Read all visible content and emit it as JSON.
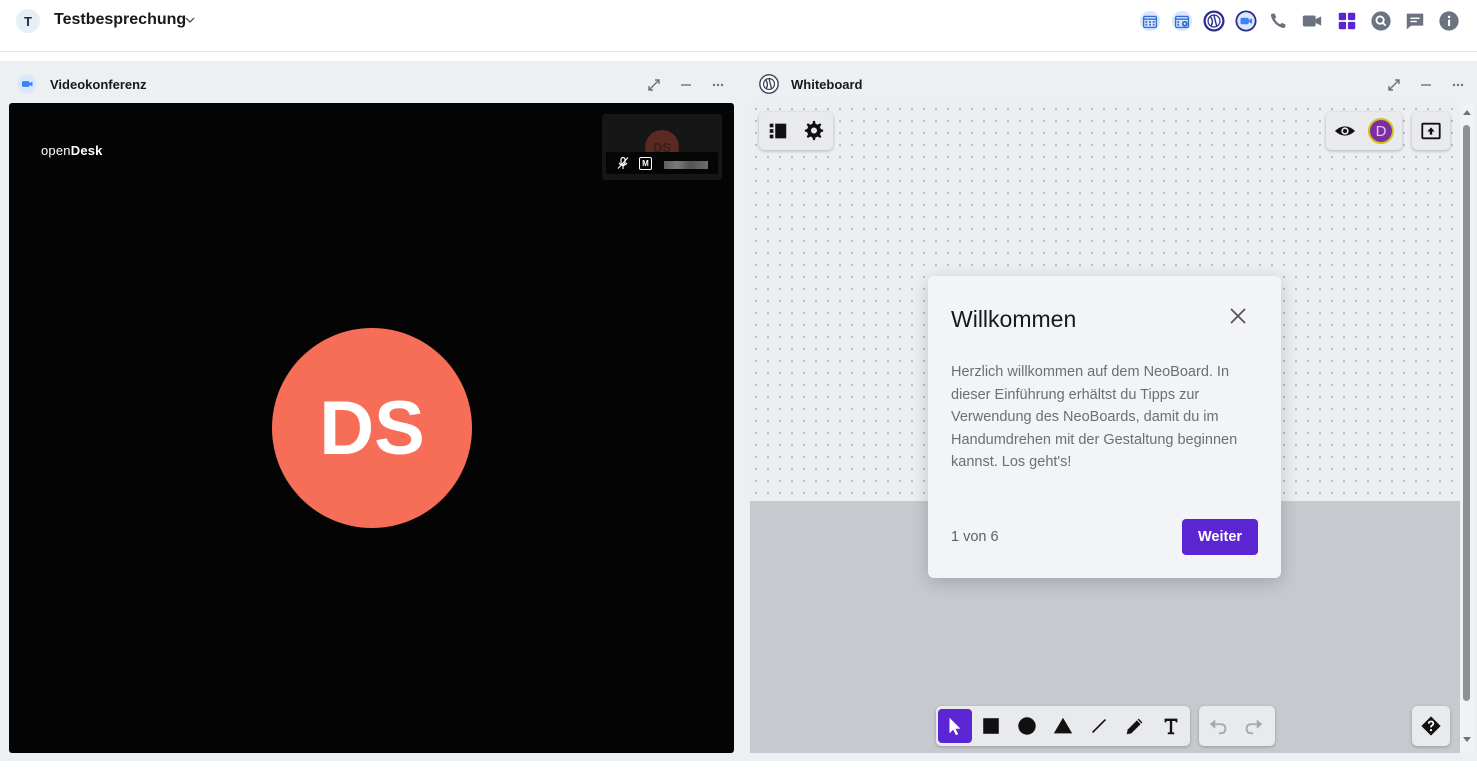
{
  "header": {
    "room_avatar": "T",
    "room_title": "Testbesprechung",
    "icons": [
      "calendar-icon",
      "calendar-settings-icon",
      "neoboard-icon",
      "video-icon",
      "phone-icon",
      "camera-icon",
      "apps-icon",
      "search-icon",
      "chat-icon",
      "info-icon"
    ],
    "colors": {
      "accent": "#5b25d3",
      "blue": "#3b82f6"
    }
  },
  "video_panel": {
    "title": "Videokonferenz",
    "logo_text_light": "open",
    "logo_text_bold": "Desk",
    "participant_initials": "DS",
    "thumbnail_initials": "DS",
    "thumbnail_badge": "M",
    "avatar_color": "#f76e58"
  },
  "whiteboard_panel": {
    "title": "Whiteboard",
    "presence_initial": "D",
    "tools": [
      "select-tool",
      "rectangle-tool",
      "circle-tool",
      "triangle-tool",
      "line-tool",
      "pen-tool",
      "text-tool"
    ],
    "history": [
      "undo",
      "redo"
    ]
  },
  "dialog": {
    "title": "Willkommen",
    "body": "Herzlich willkommen auf dem NeoBoard. In dieser Einführung erhältst du Tipps zur Verwendung des NeoBoards, damit du im Handumdrehen mit der Gestaltung beginnen kannst. Los geht's!",
    "step": "1 von 6",
    "next_label": "Weiter"
  }
}
